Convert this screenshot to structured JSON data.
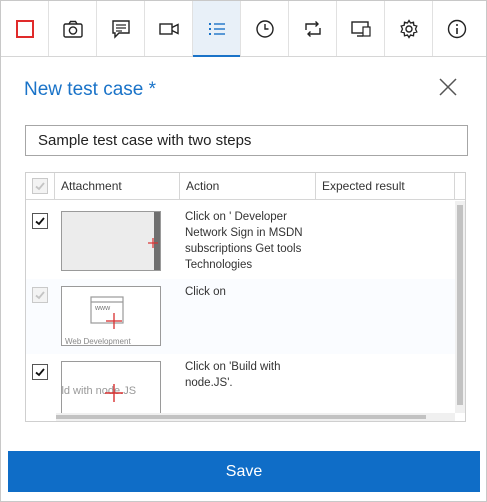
{
  "toolbar": {
    "buttons": [
      {
        "name": "stop-recording",
        "icon": "red-square-icon"
      },
      {
        "name": "screenshot",
        "icon": "camera-icon"
      },
      {
        "name": "note",
        "icon": "note-icon"
      },
      {
        "name": "video",
        "icon": "video-icon"
      },
      {
        "name": "steps",
        "icon": "list-icon",
        "active": true
      },
      {
        "name": "timeline",
        "icon": "clock-icon"
      },
      {
        "name": "sync",
        "icon": "loop-icon"
      },
      {
        "name": "system-info",
        "icon": "screen-icon"
      },
      {
        "name": "settings",
        "icon": "gear-icon"
      },
      {
        "name": "about",
        "icon": "info-icon"
      }
    ]
  },
  "dialog": {
    "title": "New test case *",
    "name_value": "Sample test case with two steps"
  },
  "grid": {
    "columns": [
      "Attachment",
      "Action",
      "Expected result"
    ],
    "rows": [
      {
        "checked": true,
        "action": "Click on ' Developer Network Sign in MSDN subscriptions Get tools Technologies",
        "thumb_caption": ""
      },
      {
        "checked": true,
        "dim": true,
        "action": "Click on",
        "thumb_caption": "Web Development",
        "thumb_text": "www"
      },
      {
        "checked": true,
        "action": "Click on 'Build with node.JS'.",
        "thumb_caption": "ild with node.JS"
      }
    ]
  },
  "footer": {
    "save_label": "Save"
  },
  "colors": {
    "accent": "#1a73c8",
    "save_button": "#0f6dc7",
    "record_red": "#e02a2a",
    "marker_red": "#d83030"
  }
}
